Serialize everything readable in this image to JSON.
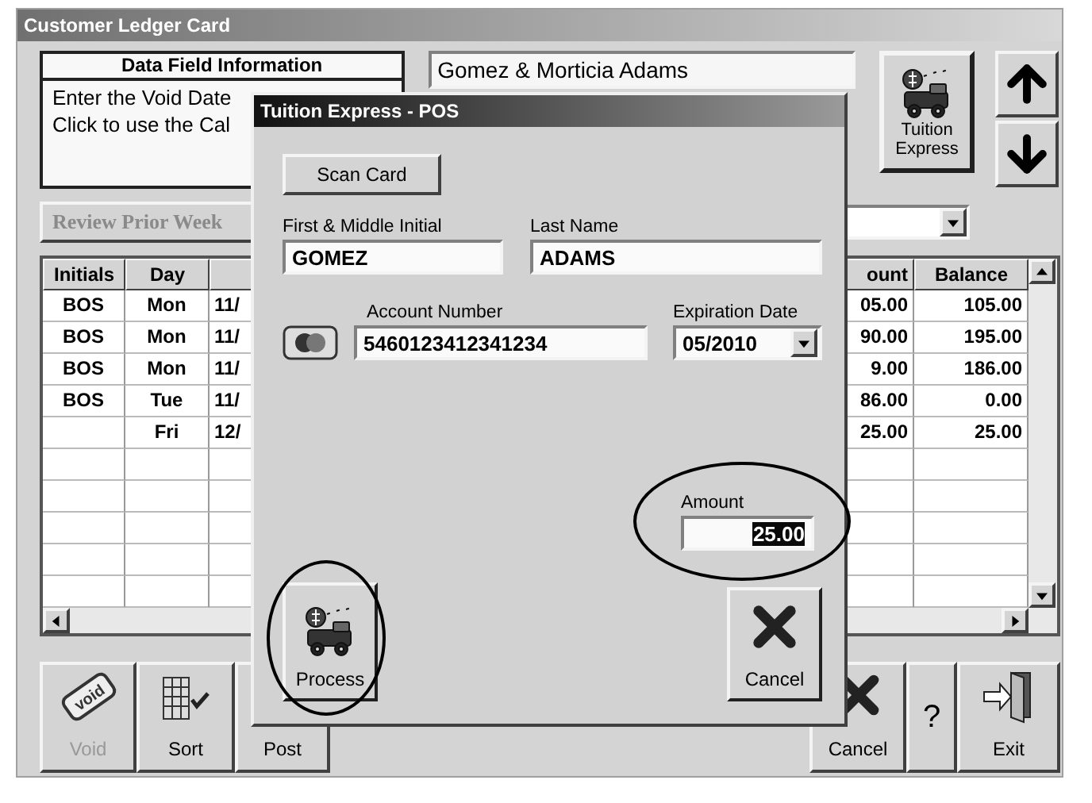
{
  "window": {
    "title": "Customer Ledger Card"
  },
  "data_field_info": {
    "heading": "Data Field Information",
    "lines": [
      "Enter the Void Date",
      "Click to use the Cal"
    ]
  },
  "customer_name": "Gomez & Morticia Adams",
  "tuition_express_button": {
    "label": "Tuition Express"
  },
  "review_button": {
    "label": "Review Prior Week",
    "disabled": true
  },
  "table": {
    "columns": [
      "Initials",
      "Day",
      "ount",
      "Balance"
    ],
    "rows": [
      {
        "initials": "BOS",
        "day": "Mon",
        "column_3": "11/",
        "amount": "05.00",
        "balance": "105.00"
      },
      {
        "initials": "BOS",
        "day": "Mon",
        "column_3": "11/",
        "amount": "90.00",
        "balance": "195.00"
      },
      {
        "initials": "BOS",
        "day": "Mon",
        "column_3": "11/",
        "amount": "9.00",
        "balance": "186.00"
      },
      {
        "initials": "BOS",
        "day": "Tue",
        "column_3": "11/",
        "amount": "86.00",
        "balance": "0.00"
      },
      {
        "day": "Fri",
        "column_3": "12/",
        "amount": "25.00",
        "balance": "25.00"
      }
    ]
  },
  "left_buttons": [
    {
      "kind": "void",
      "label": "Void",
      "icon_text": "void",
      "disabled": true
    },
    {
      "kind": "sort",
      "label": "Sort",
      "disabled": false
    },
    {
      "kind": "post",
      "label": "Post",
      "disabled": false
    }
  ],
  "right_buttons": [
    {
      "kind": "cancel",
      "label": "Cancel"
    },
    {
      "kind": "help",
      "label": "?"
    },
    {
      "kind": "exit",
      "label": "Exit"
    }
  ],
  "dialog": {
    "title": "Tuition Express - POS",
    "scan_button": "Scan Card",
    "first_name": {
      "label": "First & Middle Initial",
      "value": "GOMEZ"
    },
    "last_name": {
      "label": "Last Name",
      "value": "ADAMS"
    },
    "account_number": {
      "label": "Account Number",
      "value": "5460123412341234"
    },
    "expiration": {
      "label": "Expiration Date",
      "value": "05/2010"
    },
    "amount": {
      "label": "Amount",
      "value": "25.00",
      "text_selected": true,
      "circled": true
    },
    "process_button": {
      "label": "Process",
      "circled": true
    },
    "cancel_button": {
      "label": "Cancel"
    }
  }
}
